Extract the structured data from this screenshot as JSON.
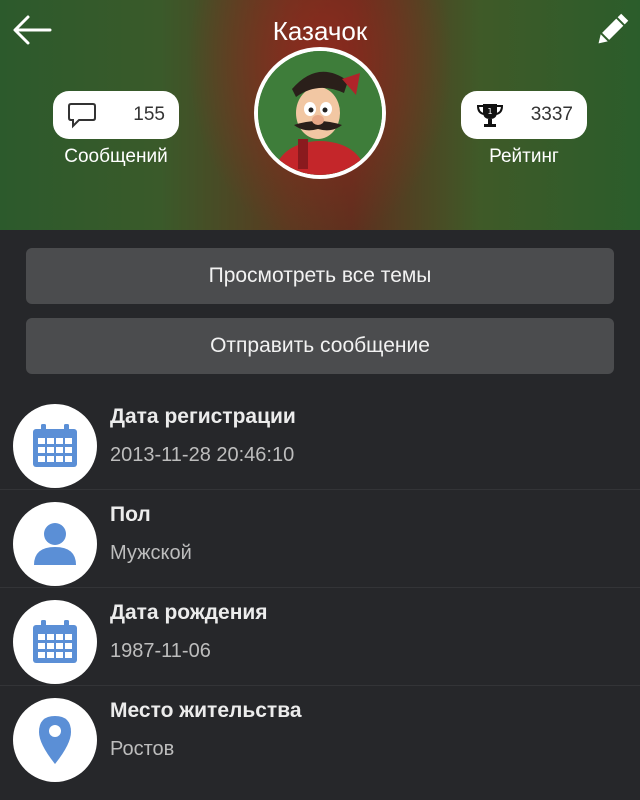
{
  "header": {
    "title": "Казачок",
    "back_icon": "arrow-left-icon",
    "edit_icon": "pencil-icon"
  },
  "stats": {
    "messages": {
      "count": "155",
      "label": "Сообщений",
      "icon": "speech-bubble-icon"
    },
    "rating": {
      "count": "3337",
      "label": "Рейтинг",
      "icon": "trophy-icon"
    }
  },
  "actions": {
    "view_topics": "Просмотреть все темы",
    "send_message": "Отправить сообщение"
  },
  "info": [
    {
      "title": "Дата регистрации",
      "value": "2013-11-28 20:46:10",
      "icon": "calendar-icon"
    },
    {
      "title": "Пол",
      "value": "Мужской",
      "icon": "user-icon"
    },
    {
      "title": "Дата рождения",
      "value": "1987-11-06",
      "icon": "calendar-icon"
    },
    {
      "title": "Место жительства",
      "value": "Ростов",
      "icon": "map-pin-icon"
    }
  ],
  "colors": {
    "background": "#26272a",
    "button": "#4b4c4e",
    "icon_blue": "#5b8fd6"
  }
}
